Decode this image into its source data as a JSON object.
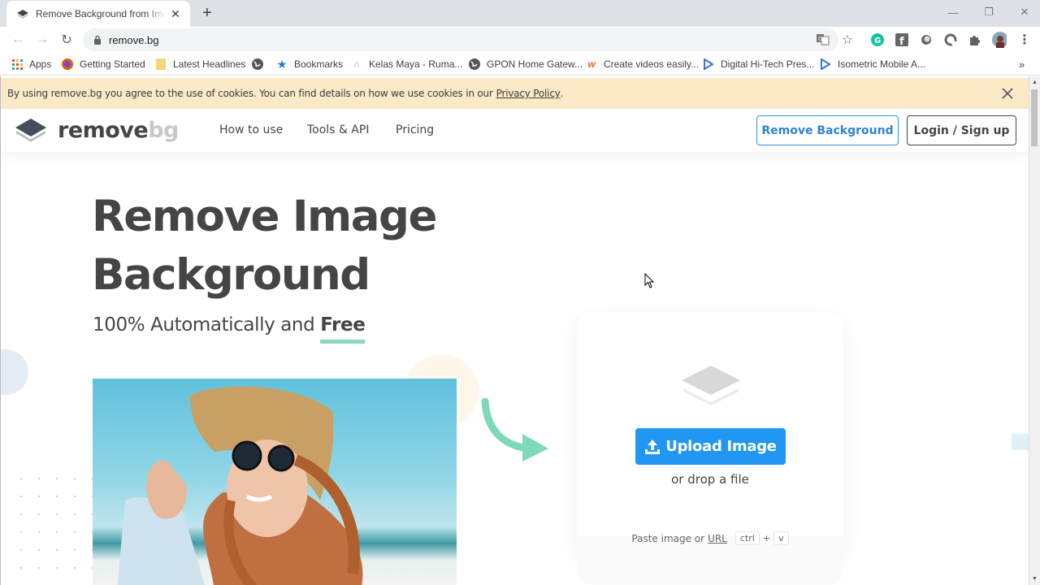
{
  "browser": {
    "tab_title": "Remove Background from Image",
    "new_tab_label": "+",
    "url": "remove.bg",
    "window_controls": [
      "minimize",
      "restore",
      "close"
    ],
    "toolbar_icons": [
      "translate-icon",
      "star-icon",
      "grammarly-icon",
      "facebook-icon",
      "circle-ext-icon",
      "refresh-ext-icon",
      "puzzle-icon",
      "profile-avatar",
      "menu-icon"
    ],
    "bookmarks": [
      {
        "label": "Apps",
        "icon": "apps-grid-icon"
      },
      {
        "label": "Getting Started",
        "icon": "firefox-icon"
      },
      {
        "label": "Latest Headlines",
        "icon": "folder-icon"
      },
      {
        "label": "",
        "icon": "globe-icon"
      },
      {
        "label": "Bookmarks",
        "icon": "star-icon"
      },
      {
        "label": "Kelas Maya - Ruma...",
        "icon": "kelas-icon"
      },
      {
        "label": "GPON Home Gatew...",
        "icon": "globe-icon"
      },
      {
        "label": "Create videos easily...",
        "icon": "w-icon"
      },
      {
        "label": "Digital Hi-Tech Pres...",
        "icon": "play-icon"
      },
      {
        "label": "Isometric Mobile A...",
        "icon": "play-icon"
      }
    ],
    "bookmarks_overflow": "»"
  },
  "cookie_banner": {
    "text": "By using remove.bg you agree to the use of cookies. You can find details on how we use cookies in our",
    "link": "Privacy Policy",
    "suffix": "."
  },
  "header": {
    "logo_word1": "remove",
    "logo_word2": "bg",
    "nav": [
      "How to use",
      "Tools & API",
      "Pricing"
    ],
    "remove_background_button": "Remove Background",
    "login_button": "Login / Sign up"
  },
  "hero": {
    "title_line1": "Remove Image",
    "title_line2": "Background",
    "subtitle_prefix": "100% Automatically and",
    "subtitle_emphasis": "Free"
  },
  "upload": {
    "button_label": "Upload Image",
    "drop_text": "or drop a file",
    "paste_text": "Paste image or",
    "url_link": "URL",
    "key1": "ctrl",
    "key_plus": "+",
    "key2": "v"
  },
  "colors": {
    "accent_blue": "#2196f3",
    "cookie_bg": "#fbe9c7",
    "underline_green": "#8ed8c0",
    "text_dark": "#454545"
  }
}
